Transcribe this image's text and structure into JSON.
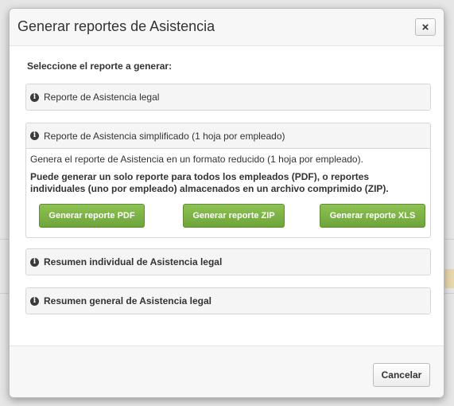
{
  "dialog": {
    "title": "Generar reportes de Asistencia",
    "close_label": "×",
    "intro": "Seleccione el reporte a generar:",
    "cancel_label": "Cancelar"
  },
  "panels": [
    {
      "title": "Reporte de Asistencia legal",
      "icon": "info-icon"
    },
    {
      "title": "Reporte de Asistencia simplificado (1 hoja por empleado)",
      "icon": "info-icon",
      "description": "Genera el reporte de Asistencia en un formato reducido (1 hoja por empleado).",
      "note": "Puede generar un solo reporte para todos los empleados (PDF), o reportes individuales (uno por empleado) almacenados en un archivo comprimido (ZIP).",
      "buttons": {
        "pdf": "Generar reporte PDF",
        "zip": "Generar reporte ZIP",
        "xls": "Generar reporte XLS"
      }
    },
    {
      "title": "Resumen individual de Asistencia legal",
      "icon": "info-icon"
    },
    {
      "title": "Resumen general de Asistencia legal",
      "icon": "info-icon"
    }
  ],
  "colors": {
    "green_button": "#7ab346",
    "overlay": "#d9d9d9"
  }
}
